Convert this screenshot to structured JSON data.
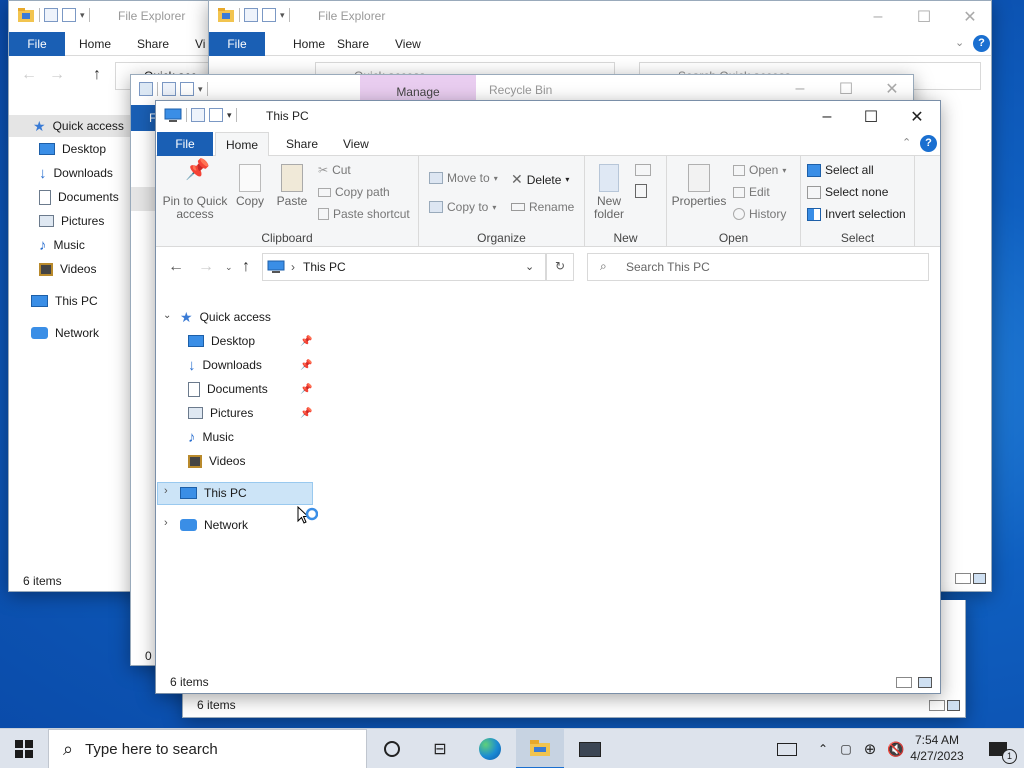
{
  "back2": {
    "title": "File Explorer",
    "tabs": [
      "File",
      "Home",
      "Share",
      "Vi"
    ],
    "sidebar": [
      {
        "label": "Quick access",
        "icon": "star-icon"
      },
      {
        "label": "Desktop",
        "icon": "desktop-icon"
      },
      {
        "label": "Downloads",
        "icon": "download-icon"
      },
      {
        "label": "Documents",
        "icon": "documents-icon"
      },
      {
        "label": "Pictures",
        "icon": "pictures-icon"
      },
      {
        "label": "Music",
        "icon": "music-icon"
      },
      {
        "label": "Videos",
        "icon": "videos-icon"
      },
      {
        "label": "This PC",
        "icon": "computer-icon"
      },
      {
        "label": "Network",
        "icon": "network-icon"
      }
    ],
    "address_fragment": "Quick acc",
    "status": "6 items"
  },
  "back1": {
    "title": "File Explorer",
    "tabs": [
      "File",
      "Home",
      "Share",
      "View"
    ],
    "address": "Quick access",
    "search_placeholder": "Search Quick access"
  },
  "back3": {
    "context_tab": "Manage",
    "title": "Recycle Bin",
    "tab_fragment": "Fi",
    "status": "6 items",
    "status_fragment": "0 i"
  },
  "main": {
    "title": "This PC",
    "tabs": {
      "file": "File",
      "home": "Home",
      "share": "Share",
      "view": "View"
    },
    "clipboard": {
      "group": "Clipboard",
      "pin": "Pin to Quick access",
      "copy": "Copy",
      "paste": "Paste",
      "cut": "Cut",
      "copy_path": "Copy path",
      "paste_shortcut": "Paste shortcut"
    },
    "organize": {
      "group": "Organize",
      "move_to": "Move to",
      "copy_to": "Copy to",
      "delete": "Delete",
      "rename": "Rename"
    },
    "new": {
      "group": "New",
      "new_folder": "New folder"
    },
    "open": {
      "group": "Open",
      "properties": "Properties",
      "open": "Open",
      "edit": "Edit",
      "history": "History"
    },
    "select": {
      "group": "Select",
      "select_all": "Select all",
      "select_none": "Select none",
      "invert": "Invert selection"
    },
    "address": "This PC",
    "search_placeholder": "Search This PC",
    "tree": {
      "quick_access": "Quick access",
      "items": [
        {
          "label": "Desktop",
          "pinned": true
        },
        {
          "label": "Downloads",
          "pinned": true
        },
        {
          "label": "Documents",
          "pinned": true
        },
        {
          "label": "Pictures",
          "pinned": true
        },
        {
          "label": "Music",
          "pinned": false
        },
        {
          "label": "Videos",
          "pinned": false
        }
      ],
      "this_pc": "This PC",
      "network": "Network"
    },
    "status": "6 items"
  },
  "taskbar": {
    "search_placeholder": "Type here to search",
    "time": "7:54 AM",
    "date": "4/27/2023",
    "notification_count": "1"
  },
  "colors": {
    "accent": "#1a5fb4",
    "selection": "#cce4f7",
    "taskbar": "#dde3ec"
  }
}
